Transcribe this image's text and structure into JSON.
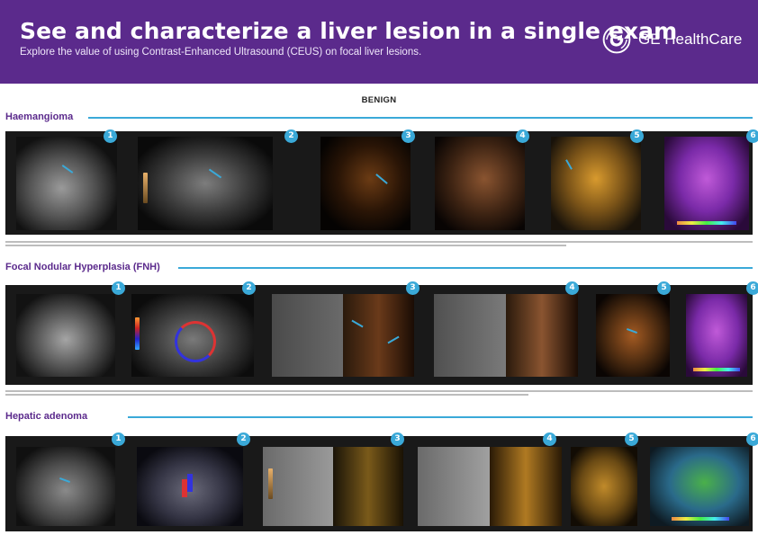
{
  "header": {
    "title": "See and characterize a liver lesion in a single exam",
    "subtitle": "Explore the value of using Contrast-Enhanced Ultrasound (CEUS) on focal liver lesions.",
    "brand_name": "GE HealthCare",
    "background_color": "#5b2a8c"
  },
  "category_heading": "BENIGN",
  "accent_color": "#3aa9d8",
  "sections": [
    {
      "title": "Haemangioma",
      "image_numbers": [
        "1",
        "2",
        "3",
        "4",
        "5",
        "6"
      ]
    },
    {
      "title": "Focal Nodular Hyperplasia (FNH)",
      "image_numbers": [
        "1",
        "2",
        "3",
        "4",
        "5",
        "6"
      ]
    },
    {
      "title": "Hepatic adenoma",
      "image_numbers": [
        "1",
        "2",
        "3",
        "4",
        "5",
        "6"
      ]
    }
  ]
}
